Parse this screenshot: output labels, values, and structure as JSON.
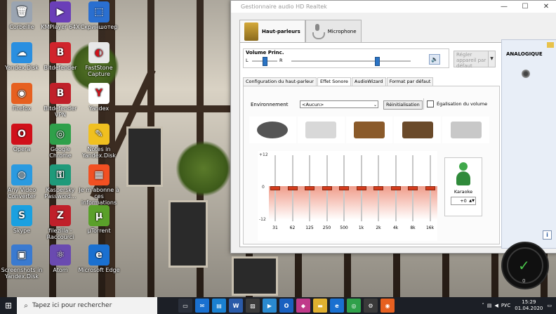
{
  "desktop": {
    "icons": [
      {
        "label": "Corbeille",
        "icon": "recycle-bin-icon",
        "color": "#9aa4b1",
        "glyph": "🗑"
      },
      {
        "label": "KMPlayer 64X",
        "icon": "kmplayer-icon",
        "color": "#6a3fb8",
        "glyph": "▶"
      },
      {
        "label": "Скриншотер",
        "icon": "screenshoter-icon",
        "color": "#2a6fd0",
        "glyph": "⬚"
      },
      {
        "label": "Yandex.Disk",
        "icon": "yandex-disk-icon",
        "color": "#2a8fe0",
        "glyph": "☁"
      },
      {
        "label": "Bitdefender",
        "icon": "bitdefender-icon",
        "color": "#d0242c",
        "glyph": "B"
      },
      {
        "label": "FastStone Capture",
        "icon": "faststone-icon",
        "color": "#e8e8e8",
        "glyph": "◐"
      },
      {
        "label": "Firefox",
        "icon": "firefox-icon",
        "color": "#e66020",
        "glyph": "◉"
      },
      {
        "label": "Bitdefender VPN",
        "icon": "bitdefender-vpn-icon",
        "color": "#c0202a",
        "glyph": "B"
      },
      {
        "label": "Yandex",
        "icon": "yandex-browser-icon",
        "color": "#ffffff",
        "glyph": "Y"
      },
      {
        "label": "Opera",
        "icon": "opera-icon",
        "color": "#d0101a",
        "glyph": "O"
      },
      {
        "label": "Google Chrome",
        "icon": "chrome-icon",
        "color": "#2fa04a",
        "glyph": "◎"
      },
      {
        "label": "Notes in Yandex.Disk",
        "icon": "notes-icon",
        "color": "#f0c020",
        "glyph": "✎"
      },
      {
        "label": "Any Video Converter",
        "icon": "any-video-converter-icon",
        "color": "#2a9ae0",
        "glyph": "◍"
      },
      {
        "label": "Kaspersky Password...",
        "icon": "kaspersky-password-icon",
        "color": "#1f9a7a",
        "glyph": "⚿"
      },
      {
        "label": "Je m'abonne à ces informations",
        "icon": "microsoft-news-icon",
        "color": "#f25022",
        "glyph": "▦"
      },
      {
        "label": "Skype",
        "icon": "skype-icon",
        "color": "#1aa0e0",
        "glyph": "S"
      },
      {
        "label": "filezilla - Raccourci",
        "icon": "filezilla-icon",
        "color": "#c0202a",
        "glyph": "Z"
      },
      {
        "label": "µTorrent",
        "icon": "utorrent-icon",
        "color": "#5aa02a",
        "glyph": "µ"
      },
      {
        "label": "Screenshots in Yandex.Disk",
        "icon": "screenshots-folder-icon",
        "color": "#3a7ad0",
        "glyph": "▣"
      },
      {
        "label": "Atom",
        "icon": "atom-icon",
        "color": "#6a4ab0",
        "glyph": "⚛"
      },
      {
        "label": "Microsoft Edge",
        "icon": "edge-icon",
        "color": "#1a70d0",
        "glyph": "e"
      }
    ]
  },
  "realtek": {
    "title": "Gestionnaire audio HD Realtek",
    "window_buttons": {
      "minimize": "—",
      "maximize": "☐",
      "close": "✕"
    },
    "device_tabs": [
      {
        "label": "Haut-parleurs",
        "active": true
      },
      {
        "label": "Microphone",
        "active": false
      }
    ],
    "volume": {
      "label": "Volume Princ.",
      "left_label": "L",
      "right_label": "R",
      "balance_fraction": 0.5,
      "volume_fraction": 0.72,
      "mute_icon": "🔈"
    },
    "default_device": {
      "label": "Régler appareil par défaut",
      "arrow": "▼"
    },
    "sub_tabs": [
      {
        "label": "Configuration du haut-parleur",
        "active": false
      },
      {
        "label": "Effet Sonore",
        "active": true
      },
      {
        "label": "AudioWizard",
        "active": false
      },
      {
        "label": "Format par défaut",
        "active": false
      }
    ],
    "environment": {
      "label": "Environnement",
      "selected": "<Aucun>",
      "arrow": "⌄",
      "reset_label": "Réinitialisation",
      "loudness_label": "Égalisation du volume",
      "loudness_checked": false,
      "presets": [
        {
          "name": "stone-icon",
          "color": "#555555"
        },
        {
          "name": "bath-icon",
          "color": "#d8d8d8"
        },
        {
          "name": "colosseum-icon",
          "color": "#8a5a2a"
        },
        {
          "name": "box-icon",
          "color": "#6a4a2a"
        },
        {
          "name": "opera-house-icon",
          "color": "#c8c8c8"
        }
      ]
    },
    "equalizer": {
      "max_label": "+12",
      "zero_label": "0",
      "min_label": "-12",
      "bands": [
        {
          "freq": "31",
          "gain_db": 0
        },
        {
          "freq": "62",
          "gain_db": 0
        },
        {
          "freq": "125",
          "gain_db": 0
        },
        {
          "freq": "250",
          "gain_db": 0
        },
        {
          "freq": "500",
          "gain_db": 0
        },
        {
          "freq": "1k",
          "gain_db": 0
        },
        {
          "freq": "2k",
          "gain_db": 0
        },
        {
          "freq": "4k",
          "gain_db": 0
        },
        {
          "freq": "8k",
          "gain_db": 0
        },
        {
          "freq": "16k",
          "gain_db": 0
        }
      ]
    },
    "karaoke": {
      "label": "Karaoke",
      "value": "+0",
      "arrows": "▲▼"
    },
    "side_panel": {
      "title": "ANALOGIQUE",
      "info_label": "i"
    }
  },
  "gauge": {
    "value": "0",
    "check": "✓"
  },
  "taskbar": {
    "start_icon": "⊞",
    "search_icon": "⌕",
    "search_placeholder": "Tapez ici pour rechercher",
    "apps": [
      {
        "name": "task-view-icon",
        "color": "#2a2f3a",
        "glyph": "▭"
      },
      {
        "name": "mail-icon",
        "color": "#1a70d0",
        "glyph": "✉"
      },
      {
        "name": "store-icon",
        "color": "#1a80d0",
        "glyph": "▤"
      },
      {
        "name": "word-icon",
        "color": "#2a5aa8",
        "glyph": "W"
      },
      {
        "name": "photos-icon",
        "color": "#3a3a3a",
        "glyph": "▨"
      },
      {
        "name": "zoom-icon",
        "color": "#2a8ad0",
        "glyph": "▶"
      },
      {
        "name": "outlook-icon",
        "color": "#1a60c0",
        "glyph": "O"
      },
      {
        "name": "kaspersky-icon",
        "color": "#c03a8a",
        "glyph": "◆"
      },
      {
        "name": "folder-icon",
        "color": "#e0b030",
        "glyph": "▬"
      },
      {
        "name": "edge-taskbar-icon",
        "color": "#1a70d0",
        "glyph": "e"
      },
      {
        "name": "chrome-taskbar-icon",
        "color": "#2fa04a",
        "glyph": "◎"
      },
      {
        "name": "settings-icon",
        "color": "#3a3a3a",
        "glyph": "⚙"
      },
      {
        "name": "firefox-taskbar-icon",
        "color": "#e66020",
        "glyph": "◉"
      }
    ],
    "tray_language": "РУС",
    "time": "15:29",
    "date": "01.04.2020"
  }
}
